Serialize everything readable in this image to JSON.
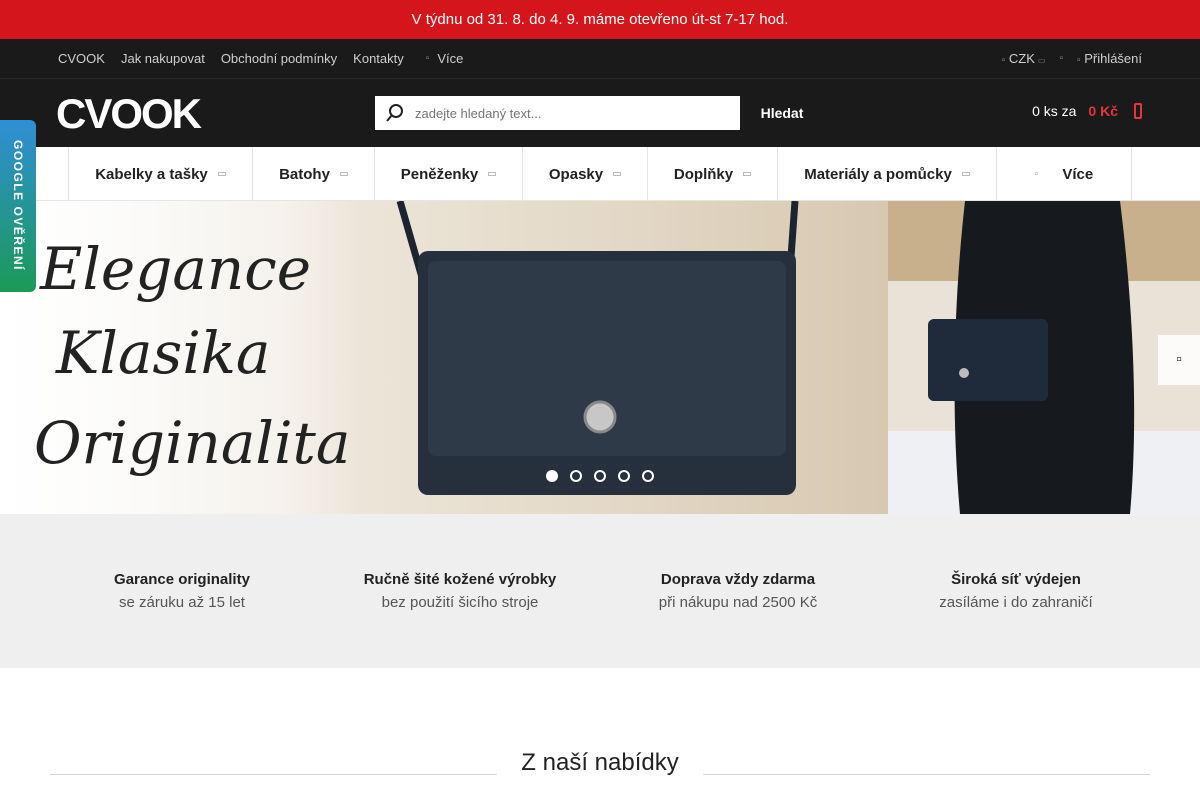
{
  "announcement": "V týdnu od 31. 8. do 4. 9. máme otevřeno út-st 7-17 hod.",
  "topbar": {
    "links": [
      "CVOOK",
      "Jak nakupovat",
      "Obchodní podmínky",
      "Kontakty"
    ],
    "more": "Více",
    "currency": "CZK",
    "login": "Přihlášení"
  },
  "header": {
    "logo_text": "CVOOK",
    "search_placeholder": "zadejte hledaný text...",
    "search_button": "Hledat",
    "cart_count": "0 ks za",
    "cart_total": "0 Kč"
  },
  "nav": {
    "items": [
      {
        "label": "Kabelky a tašky"
      },
      {
        "label": "Batohy"
      },
      {
        "label": "Peněženky"
      },
      {
        "label": "Opasky"
      },
      {
        "label": "Doplňky"
      },
      {
        "label": "Materiály a pomůcky"
      },
      {
        "label": "Více"
      }
    ]
  },
  "google_tab": "GOOGLE OVĚŘENÍ",
  "hero": {
    "words": [
      "Elegance",
      "Klasika",
      "Originalita"
    ],
    "slide_count": 5,
    "active_slide": 1
  },
  "benefits": [
    {
      "title": "Garance originality",
      "subtitle": "se záruku až 15 let"
    },
    {
      "title": "Ručně šité kožené výrobky",
      "subtitle": "bez použití šicího stroje"
    },
    {
      "title": "Doprava vždy zdarma",
      "subtitle": "při nákupu nad 2500 Kč"
    },
    {
      "title": "Široká síť výdejen",
      "subtitle": "zasíláme i do zahraničí"
    }
  ],
  "section_title": "Z naší nabídky",
  "colors": {
    "announcement_bg": "#d4151b",
    "dark_bg": "#1a1a1a",
    "accent_red": "#e8343b",
    "benefits_bg": "#efefef"
  }
}
